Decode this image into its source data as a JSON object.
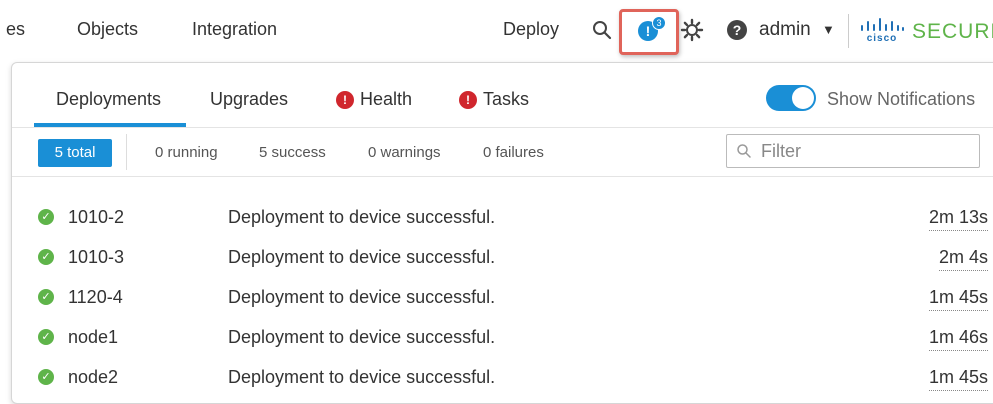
{
  "topbar": {
    "nav": [
      "es",
      "Objects",
      "Integration"
    ],
    "deploy_label": "Deploy",
    "notifications": {
      "count": "3",
      "icon": "notification-alert-icon"
    },
    "user": "admin",
    "brand": {
      "logo_text": "cisco",
      "product": "SECURE"
    },
    "colors": {
      "accent": "#1a8fd6",
      "highlight_border": "#e0645a",
      "brand_green": "#5fb44a"
    }
  },
  "panel": {
    "tabs": [
      {
        "label": "Deployments",
        "active": true
      },
      {
        "label": "Upgrades"
      },
      {
        "label": "Health",
        "alert_icon": "error-icon"
      },
      {
        "label": "Tasks",
        "alert_icon": "error-icon"
      }
    ],
    "show_notifications": {
      "label": "Show Notifications",
      "enabled": true
    },
    "stats": {
      "total": "5 total",
      "running": "0 running",
      "success": "5 success",
      "warnings": "0 warnings",
      "failures": "0 failures"
    },
    "filter": {
      "placeholder": "Filter",
      "value": ""
    },
    "rows": [
      {
        "device": "1010-2",
        "message": "Deployment to device successful.",
        "time": "2m 13s"
      },
      {
        "device": "1010-3",
        "message": "Deployment to device successful.",
        "time": "2m 4s"
      },
      {
        "device": "1120-4",
        "message": "Deployment to device successful.",
        "time": "1m 45s"
      },
      {
        "device": "node1",
        "message": "Deployment to device successful.",
        "time": "1m 46s"
      },
      {
        "device": "node2",
        "message": "Deployment to device successful.",
        "time": "1m 45s"
      }
    ]
  }
}
